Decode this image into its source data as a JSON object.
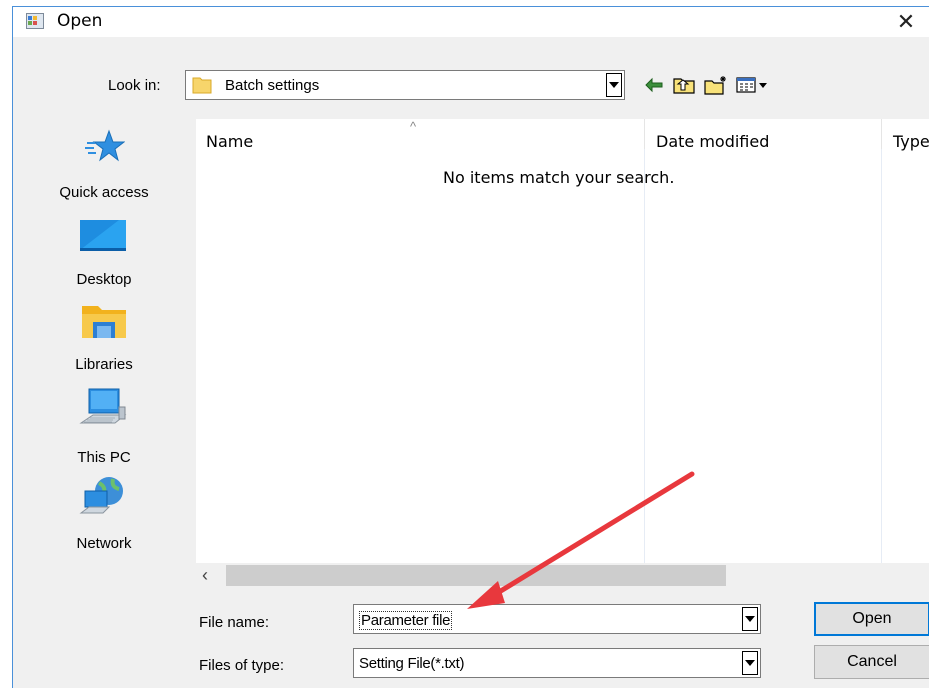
{
  "dialog": {
    "title": "Open",
    "close_glyph": "✕"
  },
  "look_in": {
    "label": "Look in:",
    "value": "Batch settings"
  },
  "toolbar": {
    "icons": [
      "back-icon",
      "up-folder-icon",
      "new-folder-icon",
      "view-menu-icon"
    ]
  },
  "places": [
    {
      "label": "Quick access",
      "icon": "star-icon"
    },
    {
      "label": "Desktop",
      "icon": "desktop-icon"
    },
    {
      "label": "Libraries",
      "icon": "libraries-icon"
    },
    {
      "label": "This PC",
      "icon": "computer-icon"
    },
    {
      "label": "Network",
      "icon": "network-icon"
    }
  ],
  "file_list": {
    "columns": [
      "Name",
      "Date modified",
      "Type"
    ],
    "empty_message": "No items match your search.",
    "sort_indicator": "^"
  },
  "file_name": {
    "label": "File name:",
    "value": "Parameter file"
  },
  "file_type": {
    "label": "Files of type:",
    "value": "Setting File(*.txt)"
  },
  "buttons": {
    "open": "Open",
    "cancel": "Cancel"
  },
  "colors": {
    "accent": "#0078d7",
    "annotation_arrow": "#e8383d",
    "frame_border": "#4a90d9"
  }
}
